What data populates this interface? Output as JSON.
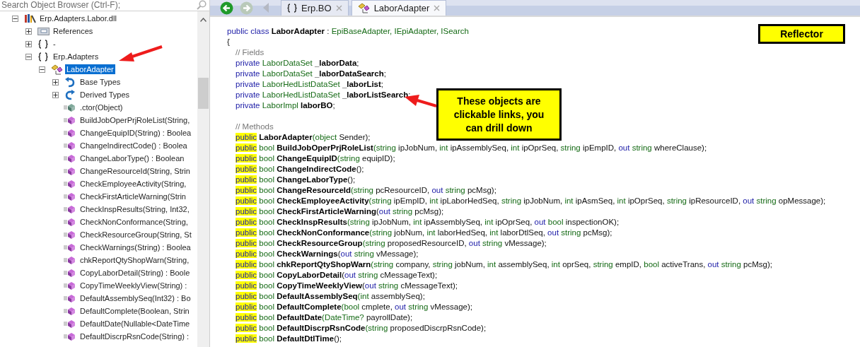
{
  "search": {
    "placeholder": "Search Object Browser (Ctrl-F);"
  },
  "tree": [
    {
      "label": "Erp.Adapters.Labor.dll",
      "kind": "assembly",
      "expanded": true,
      "selected": false,
      "children": [
        {
          "label": "References",
          "kind": "references",
          "expanded": false,
          "selected": false
        },
        {
          "label": "-",
          "kind": "namespace",
          "expanded": false,
          "selected": false
        },
        {
          "label": "Erp.Adapters",
          "kind": "namespace",
          "expanded": true,
          "selected": false,
          "children": [
            {
              "label": "LaborAdapter",
              "kind": "class",
              "expanded": true,
              "selected": true,
              "children": [
                {
                  "label": "Base Types",
                  "kind": "base-types",
                  "expanded": false,
                  "selected": false
                },
                {
                  "label": "Derived Types",
                  "kind": "derived-types",
                  "expanded": false,
                  "selected": false
                },
                {
                  "label": ".ctor(Object)",
                  "kind": "ctor",
                  "selected": false
                },
                {
                  "label": "BuildJobOperPrjRoleList(String,",
                  "kind": "method",
                  "selected": false
                },
                {
                  "label": "ChangeEquipID(String) : Boolea",
                  "kind": "method",
                  "selected": false
                },
                {
                  "label": "ChangeIndirectCode() : Boolea",
                  "kind": "method",
                  "selected": false
                },
                {
                  "label": "ChangeLaborType() : Boolean",
                  "kind": "method",
                  "selected": false
                },
                {
                  "label": "ChangeResourceId(String, Strin",
                  "kind": "method",
                  "selected": false
                },
                {
                  "label": "CheckEmployeeActivity(String,",
                  "kind": "method",
                  "selected": false
                },
                {
                  "label": "CheckFirstArticleWarning(Strin",
                  "kind": "method",
                  "selected": false
                },
                {
                  "label": "CheckInspResults(String, Int32,",
                  "kind": "method",
                  "selected": false
                },
                {
                  "label": "CheckNonConformance(String,",
                  "kind": "method",
                  "selected": false
                },
                {
                  "label": "CheckResourceGroup(String, St",
                  "kind": "method",
                  "selected": false
                },
                {
                  "label": "CheckWarnings(String) : Boolea",
                  "kind": "method",
                  "selected": false
                },
                {
                  "label": "chkReportQtyShopWarn(String,",
                  "kind": "method",
                  "selected": false
                },
                {
                  "label": "CopyLaborDetail(String) : Boole",
                  "kind": "method",
                  "selected": false
                },
                {
                  "label": "CopyTimeWeeklyView(String) :",
                  "kind": "method",
                  "selected": false
                },
                {
                  "label": "DefaultAssemblySeq(Int32) : Bo",
                  "kind": "method",
                  "selected": false
                },
                {
                  "label": "DefaultComplete(Boolean, Strin",
                  "kind": "method",
                  "selected": false
                },
                {
                  "label": "DefaultDate(Nullable<DateTime",
                  "kind": "method",
                  "selected": false
                },
                {
                  "label": "DefaultDiscrpRsnCode(String) :",
                  "kind": "method",
                  "selected": false
                }
              ]
            }
          ]
        }
      ]
    }
  ],
  "nav_buttons": [
    {
      "kind": "back",
      "disabled": false
    },
    {
      "kind": "forward",
      "disabled": true
    },
    {
      "kind": "previous",
      "disabled": true
    }
  ],
  "tabs": [
    {
      "label": "Erp.BO",
      "kind": "namespace",
      "selected": false
    },
    {
      "label": "LaborAdapter",
      "kind": "class",
      "selected": true
    }
  ],
  "code": {
    "declaration": [
      {
        "kind": "kw",
        "text": "public class "
      },
      {
        "kind": "name",
        "text": "LaborAdapter"
      },
      {
        "kind": "plain",
        "text": " : "
      },
      {
        "kind": "type",
        "text": "EpiBaseAdapter, IEpiAdapter, ISearch"
      }
    ],
    "open_brace": "{",
    "fields_comment": "// Fields",
    "fields": [
      [
        {
          "kind": "kw",
          "text": "private "
        },
        {
          "kind": "type",
          "text": "LaborDataSet "
        },
        {
          "kind": "name",
          "text": "_laborData"
        },
        {
          "kind": "plain",
          "text": ";"
        }
      ],
      [
        {
          "kind": "kw",
          "text": "private "
        },
        {
          "kind": "type",
          "text": "LaborDataSet "
        },
        {
          "kind": "name",
          "text": "_laborDataSearch"
        },
        {
          "kind": "plain",
          "text": ";"
        }
      ],
      [
        {
          "kind": "kw",
          "text": "private "
        },
        {
          "kind": "type",
          "text": "LaborHedListDataSet "
        },
        {
          "kind": "name",
          "text": "_laborList"
        },
        {
          "kind": "plain",
          "text": ";"
        }
      ],
      [
        {
          "kind": "kw",
          "text": "private "
        },
        {
          "kind": "type",
          "text": "LaborHedListDataSet "
        },
        {
          "kind": "name",
          "text": "_laborListSearch"
        },
        {
          "kind": "plain",
          "text": ";"
        }
      ],
      [
        {
          "kind": "kw",
          "text": "private "
        },
        {
          "kind": "type",
          "text": "LaborImpl "
        },
        {
          "kind": "name",
          "text": "laborBO"
        },
        {
          "kind": "plain",
          "text": ";"
        }
      ]
    ],
    "methods_comment": "// Methods",
    "methods": [
      [
        {
          "kind": "mark",
          "text": "public"
        },
        {
          "kind": "name",
          "text": " LaborAdapter"
        },
        {
          "kind": "type",
          "text": "(object"
        },
        {
          "kind": "plain",
          "text": " Sender);"
        }
      ],
      [
        {
          "kind": "mark",
          "text": "public"
        },
        {
          "kind": "type",
          "text": " bool "
        },
        {
          "kind": "name",
          "text": "BuildJobOperPrjRoleList"
        },
        {
          "kind": "type",
          "text": "(string "
        },
        {
          "kind": "plain",
          "text": "ipJobNum, "
        },
        {
          "kind": "type",
          "text": "int "
        },
        {
          "kind": "plain",
          "text": "ipAssemblySeq, "
        },
        {
          "kind": "type",
          "text": "int "
        },
        {
          "kind": "plain",
          "text": "ipOprSeq, "
        },
        {
          "kind": "type",
          "text": "string "
        },
        {
          "kind": "plain",
          "text": "ipEmpID, "
        },
        {
          "kind": "kw",
          "text": "out "
        },
        {
          "kind": "type",
          "text": "string "
        },
        {
          "kind": "plain",
          "text": "whereClause);"
        }
      ],
      [
        {
          "kind": "mark",
          "text": "public"
        },
        {
          "kind": "type",
          "text": " bool "
        },
        {
          "kind": "name",
          "text": "ChangeEquipID"
        },
        {
          "kind": "type",
          "text": "(string "
        },
        {
          "kind": "plain",
          "text": "equipID);"
        }
      ],
      [
        {
          "kind": "mark",
          "text": "public"
        },
        {
          "kind": "type",
          "text": " bool "
        },
        {
          "kind": "name",
          "text": "ChangeIndirectCode"
        },
        {
          "kind": "plain",
          "text": "();"
        }
      ],
      [
        {
          "kind": "mark",
          "text": "public"
        },
        {
          "kind": "type",
          "text": " bool "
        },
        {
          "kind": "name",
          "text": "ChangeLaborType"
        },
        {
          "kind": "plain",
          "text": "();"
        }
      ],
      [
        {
          "kind": "mark",
          "text": "public"
        },
        {
          "kind": "type",
          "text": " bool "
        },
        {
          "kind": "name",
          "text": "ChangeResourceId"
        },
        {
          "kind": "type",
          "text": "(string "
        },
        {
          "kind": "plain",
          "text": "pcResourceID, "
        },
        {
          "kind": "kw",
          "text": "out "
        },
        {
          "kind": "type",
          "text": "string "
        },
        {
          "kind": "plain",
          "text": "pcMsg);"
        }
      ],
      [
        {
          "kind": "mark",
          "text": "public"
        },
        {
          "kind": "type",
          "text": " bool "
        },
        {
          "kind": "name",
          "text": "CheckEmployeeActivity"
        },
        {
          "kind": "type",
          "text": "(string "
        },
        {
          "kind": "plain",
          "text": "ipEmpID, "
        },
        {
          "kind": "type",
          "text": "int "
        },
        {
          "kind": "plain",
          "text": "ipLaborHedSeq, "
        },
        {
          "kind": "type",
          "text": "string "
        },
        {
          "kind": "plain",
          "text": "ipJobNum, "
        },
        {
          "kind": "type",
          "text": "int "
        },
        {
          "kind": "plain",
          "text": "ipAsmSeq, "
        },
        {
          "kind": "type",
          "text": "int "
        },
        {
          "kind": "plain",
          "text": "ipOprSeq, "
        },
        {
          "kind": "type",
          "text": "string "
        },
        {
          "kind": "plain",
          "text": "ipResourceID, "
        },
        {
          "kind": "kw",
          "text": "out "
        },
        {
          "kind": "type",
          "text": "string "
        },
        {
          "kind": "plain",
          "text": "opMessage);"
        }
      ],
      [
        {
          "kind": "mark",
          "text": "public"
        },
        {
          "kind": "type",
          "text": " bool "
        },
        {
          "kind": "name",
          "text": "CheckFirstArticleWarning"
        },
        {
          "kind": "plain",
          "text": "("
        },
        {
          "kind": "kw",
          "text": "out "
        },
        {
          "kind": "type",
          "text": "string "
        },
        {
          "kind": "plain",
          "text": "pcMsg);"
        }
      ],
      [
        {
          "kind": "mark",
          "text": "public"
        },
        {
          "kind": "type",
          "text": " bool "
        },
        {
          "kind": "name",
          "text": "CheckInspResults"
        },
        {
          "kind": "type",
          "text": "(string "
        },
        {
          "kind": "plain",
          "text": "ipJobNum, "
        },
        {
          "kind": "type",
          "text": "int "
        },
        {
          "kind": "plain",
          "text": "ipAssemblySeq, "
        },
        {
          "kind": "type",
          "text": "int "
        },
        {
          "kind": "plain",
          "text": "ipOprSeq, "
        },
        {
          "kind": "kw",
          "text": "out "
        },
        {
          "kind": "type",
          "text": "bool "
        },
        {
          "kind": "plain",
          "text": "inspectionOK);"
        }
      ],
      [
        {
          "kind": "mark",
          "text": "public"
        },
        {
          "kind": "type",
          "text": " bool "
        },
        {
          "kind": "name",
          "text": "CheckNonConformance"
        },
        {
          "kind": "type",
          "text": "(string "
        },
        {
          "kind": "plain",
          "text": "jobNum, "
        },
        {
          "kind": "type",
          "text": "int "
        },
        {
          "kind": "plain",
          "text": "laborHedSeq, "
        },
        {
          "kind": "type",
          "text": "int "
        },
        {
          "kind": "plain",
          "text": "laborDtlSeq, "
        },
        {
          "kind": "kw",
          "text": "out "
        },
        {
          "kind": "type",
          "text": "string "
        },
        {
          "kind": "plain",
          "text": "pcMsg);"
        }
      ],
      [
        {
          "kind": "mark",
          "text": "public"
        },
        {
          "kind": "type",
          "text": " bool "
        },
        {
          "kind": "name",
          "text": "CheckResourceGroup"
        },
        {
          "kind": "type",
          "text": "(string "
        },
        {
          "kind": "plain",
          "text": "proposedResourceID, "
        },
        {
          "kind": "kw",
          "text": "out "
        },
        {
          "kind": "type",
          "text": "string "
        },
        {
          "kind": "plain",
          "text": "vMessage);"
        }
      ],
      [
        {
          "kind": "mark",
          "text": "public"
        },
        {
          "kind": "type",
          "text": " bool "
        },
        {
          "kind": "name",
          "text": "CheckWarnings"
        },
        {
          "kind": "plain",
          "text": "("
        },
        {
          "kind": "kw",
          "text": "out "
        },
        {
          "kind": "type",
          "text": "string "
        },
        {
          "kind": "plain",
          "text": "vMessage);"
        }
      ],
      [
        {
          "kind": "mark",
          "text": "public"
        },
        {
          "kind": "type",
          "text": " bool "
        },
        {
          "kind": "name",
          "text": "chkReportQtyShopWarn"
        },
        {
          "kind": "type",
          "text": "(string "
        },
        {
          "kind": "plain",
          "text": "company, "
        },
        {
          "kind": "type",
          "text": "string "
        },
        {
          "kind": "plain",
          "text": "jobNum, "
        },
        {
          "kind": "type",
          "text": "int "
        },
        {
          "kind": "plain",
          "text": "assemblySeq, "
        },
        {
          "kind": "type",
          "text": "int "
        },
        {
          "kind": "plain",
          "text": "oprSeq, "
        },
        {
          "kind": "type",
          "text": "string "
        },
        {
          "kind": "plain",
          "text": "empID, "
        },
        {
          "kind": "type",
          "text": "bool "
        },
        {
          "kind": "plain",
          "text": "activeTrans, "
        },
        {
          "kind": "kw",
          "text": "out "
        },
        {
          "kind": "type",
          "text": "string "
        },
        {
          "kind": "plain",
          "text": "pcMsg);"
        }
      ],
      [
        {
          "kind": "mark",
          "text": "public"
        },
        {
          "kind": "type",
          "text": " bool "
        },
        {
          "kind": "name",
          "text": "CopyLaborDetail"
        },
        {
          "kind": "plain",
          "text": "("
        },
        {
          "kind": "kw",
          "text": "out "
        },
        {
          "kind": "type",
          "text": "string "
        },
        {
          "kind": "plain",
          "text": "cMessageText);"
        }
      ],
      [
        {
          "kind": "mark",
          "text": "public"
        },
        {
          "kind": "type",
          "text": " bool "
        },
        {
          "kind": "name",
          "text": "CopyTimeWeeklyView"
        },
        {
          "kind": "plain",
          "text": "("
        },
        {
          "kind": "kw",
          "text": "out "
        },
        {
          "kind": "type",
          "text": "string "
        },
        {
          "kind": "plain",
          "text": "cMessageText);"
        }
      ],
      [
        {
          "kind": "mark",
          "text": "public"
        },
        {
          "kind": "type",
          "text": " bool "
        },
        {
          "kind": "name",
          "text": "DefaultAssemblySeq"
        },
        {
          "kind": "type",
          "text": "(int "
        },
        {
          "kind": "plain",
          "text": "assemblySeq);"
        }
      ],
      [
        {
          "kind": "mark",
          "text": "public"
        },
        {
          "kind": "type",
          "text": " bool "
        },
        {
          "kind": "name",
          "text": "DefaultComplete"
        },
        {
          "kind": "type",
          "text": "(bool "
        },
        {
          "kind": "plain",
          "text": "cmplete, "
        },
        {
          "kind": "kw",
          "text": "out "
        },
        {
          "kind": "type",
          "text": "string "
        },
        {
          "kind": "plain",
          "text": "vMessage);"
        }
      ],
      [
        {
          "kind": "mark",
          "text": "public"
        },
        {
          "kind": "type",
          "text": " bool "
        },
        {
          "kind": "name",
          "text": "DefaultDate"
        },
        {
          "kind": "type",
          "text": "(DateTime? "
        },
        {
          "kind": "plain",
          "text": "payrollDate);"
        }
      ],
      [
        {
          "kind": "mark",
          "text": "public"
        },
        {
          "kind": "type",
          "text": " bool "
        },
        {
          "kind": "name",
          "text": "DefaultDiscrpRsnCode"
        },
        {
          "kind": "type",
          "text": "(string "
        },
        {
          "kind": "plain",
          "text": "proposedDiscrpRsnCode);"
        }
      ],
      [
        {
          "kind": "mark",
          "text": "public"
        },
        {
          "kind": "type",
          "text": " bool "
        },
        {
          "kind": "name",
          "text": "DefaultDtlTime"
        },
        {
          "kind": "plain",
          "text": "();"
        }
      ]
    ]
  },
  "annotations": [
    {
      "kind": "label",
      "text": "Reflector"
    },
    {
      "kind": "callout",
      "text": "These objects are clickable links, you can drill down"
    }
  ]
}
